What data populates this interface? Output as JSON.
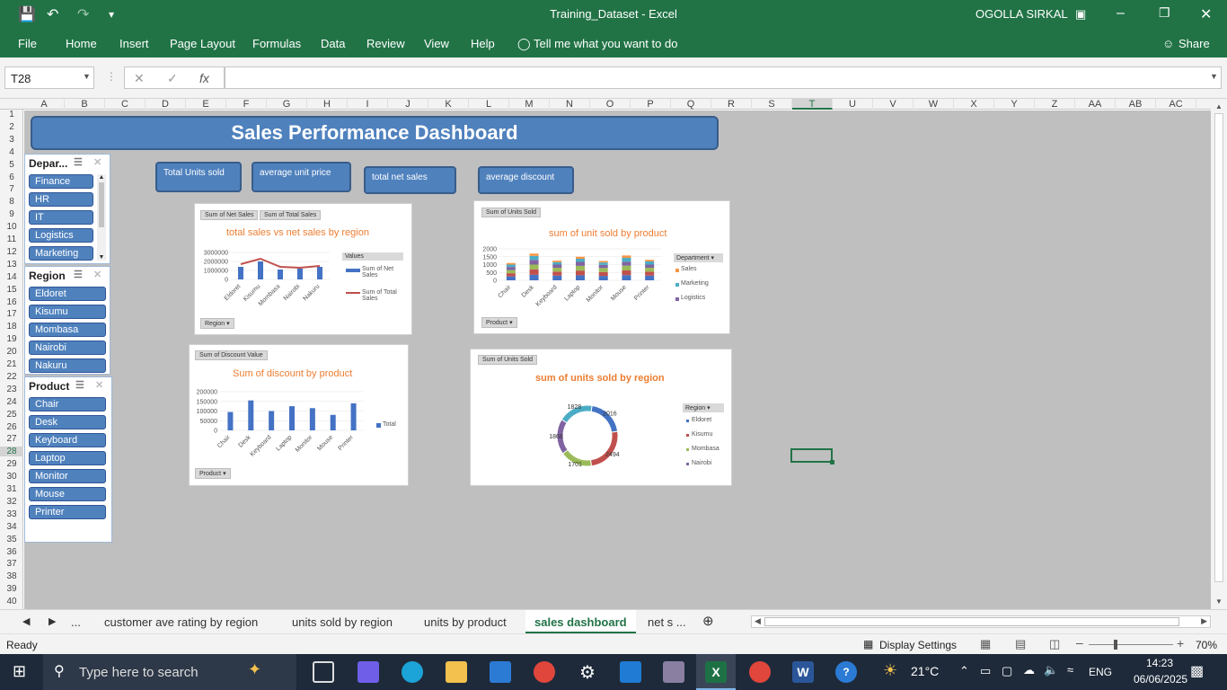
{
  "app": {
    "doc_title": "Training_Dataset  -  Excel",
    "user": "OGOLLA SIRKAL"
  },
  "menu": [
    "File",
    "Home",
    "Insert",
    "Page Layout",
    "Formulas",
    "Data",
    "Review",
    "View",
    "Help",
    "Tell me what you want to do",
    "Share"
  ],
  "formula_bar": {
    "name_box": "T28",
    "fx": "fx",
    "formula": ""
  },
  "columns": [
    "A",
    "B",
    "C",
    "D",
    "E",
    "F",
    "G",
    "H",
    "I",
    "J",
    "K",
    "L",
    "M",
    "N",
    "O",
    "P",
    "Q",
    "R",
    "S",
    "T",
    "U",
    "V",
    "W",
    "X",
    "Y",
    "Z",
    "AA",
    "AB",
    "AC"
  ],
  "rows": [
    "1",
    "2",
    "3",
    "4",
    "5",
    "6",
    "7",
    "8",
    "9",
    "10",
    "11",
    "12",
    "13",
    "14",
    "15",
    "16",
    "17",
    "18",
    "19",
    "20",
    "21",
    "22",
    "23",
    "24",
    "25",
    "26",
    "27",
    "28",
    "29",
    "30",
    "31",
    "32",
    "33",
    "34",
    "35",
    "36",
    "37",
    "38",
    "39",
    "40"
  ],
  "dashboard": {
    "title": "Sales Performance Dashboard",
    "kpis": [
      "Total Units sold",
      "average unit price",
      "total net sales",
      "average discount"
    ]
  },
  "slicers": {
    "department": {
      "title": "Depar...",
      "items": [
        "Finance",
        "HR",
        "IT",
        "Logistics",
        "Marketing"
      ]
    },
    "region": {
      "title": "Region",
      "items": [
        "Eldoret",
        "Kisumu",
        "Mombasa",
        "Nairobi",
        "Nakuru"
      ]
    },
    "product": {
      "title": "Product",
      "items": [
        "Chair",
        "Desk",
        "Keyboard",
        "Laptop",
        "Monitor",
        "Mouse",
        "Printer"
      ]
    }
  },
  "chart_data": [
    {
      "type": "bar",
      "title": "total sales vs net sales by region",
      "pivot_buttons": [
        "Sum of Net Sales",
        "Sum of Total Sales"
      ],
      "field_button": "Region",
      "legend_title": "Values",
      "categories": [
        "Eldoret",
        "Kisumu",
        "Mombasa",
        "Nairobi",
        "Nakuru"
      ],
      "series": [
        {
          "name": "Sum of Net Sales",
          "type": "bar",
          "color": "#4472c4",
          "values": [
            1400000,
            2000000,
            1100000,
            1200000,
            1400000
          ]
        },
        {
          "name": "Sum of Total Sales",
          "type": "line",
          "color": "#c0504d",
          "values": [
            1700000,
            2300000,
            1400000,
            1300000,
            1500000
          ]
        }
      ],
      "yticks": [
        "3000000",
        "2000000",
        "1000000",
        "0"
      ],
      "ylim": [
        0,
        3000000
      ]
    },
    {
      "type": "bar",
      "stacked": true,
      "title": "sum of unit sold by product",
      "pivot_buttons": [
        "Sum of Units Sold"
      ],
      "field_button": "Product",
      "legend_title": "Department",
      "categories": [
        "Chair",
        "Desk",
        "Keyboard",
        "Laptop",
        "Monitor",
        "Mouse",
        "Printer"
      ],
      "series": [
        {
          "name": "Finance",
          "color": "#4472c4",
          "values": [
            250,
            350,
            300,
            320,
            280,
            330,
            300
          ]
        },
        {
          "name": "HR",
          "color": "#c0504d",
          "values": [
            200,
            350,
            250,
            300,
            250,
            300,
            250
          ]
        },
        {
          "name": "IT",
          "color": "#9bbb59",
          "values": [
            200,
            300,
            250,
            300,
            250,
            300,
            250
          ]
        },
        {
          "name": "Logistics",
          "color": "#8064a2",
          "values": [
            200,
            300,
            200,
            250,
            200,
            250,
            200
          ]
        },
        {
          "name": "Marketing",
          "color": "#4bacc6",
          "values": [
            150,
            250,
            150,
            200,
            150,
            250,
            200
          ]
        },
        {
          "name": "Sales",
          "color": "#f79646",
          "values": [
            100,
            150,
            100,
            130,
            100,
            150,
            100
          ]
        }
      ],
      "legend_visible": [
        "Sales",
        "Marketing",
        "Logistics"
      ],
      "yticks": [
        "2000",
        "1500",
        "1000",
        "500",
        "0"
      ],
      "ylim": [
        0,
        2000
      ]
    },
    {
      "type": "bar",
      "title": "Sum of discount by product",
      "pivot_buttons": [
        "Sum of Discount Value"
      ],
      "field_button": "Product",
      "categories": [
        "Chair",
        "Desk",
        "Keyboard",
        "Laptop",
        "Monitor",
        "Mouse",
        "Printer"
      ],
      "series": [
        {
          "name": "Total",
          "color": "#4472c4",
          "values": [
            95000,
            155000,
            100000,
            125000,
            115000,
            80000,
            140000
          ]
        }
      ],
      "yticks": [
        "200000",
        "150000",
        "100000",
        "50000",
        "0"
      ],
      "ylim": [
        0,
        200000
      ]
    },
    {
      "type": "pie",
      "donut": true,
      "title": "sum of units sold by region",
      "pivot_buttons": [
        "Sum of Units Sold"
      ],
      "legend_title": "Region",
      "categories": [
        "Eldoret",
        "Kisumu",
        "Mombasa",
        "Nairobi",
        "Nakuru"
      ],
      "values": [
        2016,
        2494,
        1701,
        1868,
        1828
      ],
      "labels": [
        "2016",
        "2494",
        "1701",
        "1868",
        "1828"
      ],
      "colors": [
        "#4472c4",
        "#c0504d",
        "#9bbb59",
        "#8064a2",
        "#4bacc6"
      ],
      "legend_visible": [
        "Eldoret",
        "Kisumu",
        "Mombasa",
        "Nairobi"
      ]
    }
  ],
  "sheet_tabs": {
    "items": [
      "customer ave rating by region",
      "units sold by region",
      "units by product",
      "sales dashboard",
      "net s ..."
    ],
    "active": "sales dashboard",
    "more": "..."
  },
  "status": {
    "ready": "Ready",
    "display_settings": "Display Settings",
    "zoom": "70%"
  },
  "taskbar": {
    "search_placeholder": "Type here to search",
    "temperature": "21°C",
    "lang": "ENG",
    "time": "14:23",
    "date": "06/06/2025"
  }
}
